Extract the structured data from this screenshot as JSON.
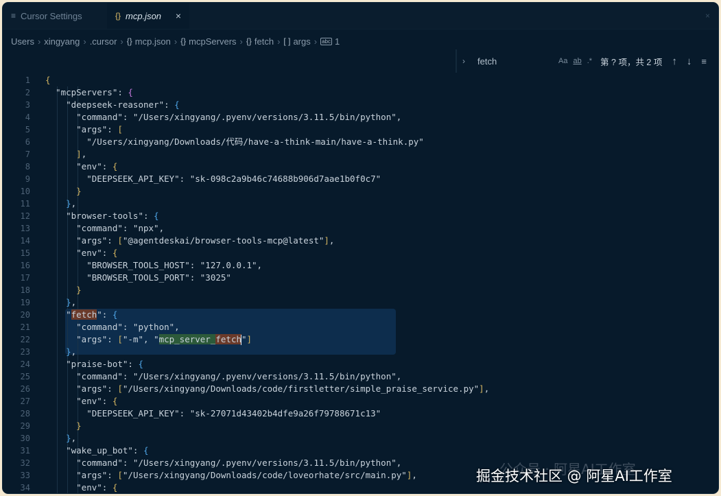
{
  "tabs": [
    {
      "label": "Cursor Settings",
      "icon": "settings-lines-icon",
      "active": false
    },
    {
      "label": "mcp.json",
      "icon": "json-braces-icon",
      "active": true
    }
  ],
  "breadcrumb": {
    "items": [
      "Users",
      "xingyang",
      ".cursor",
      "mcp.json",
      "mcpServers",
      "fetch",
      "args",
      "1"
    ],
    "icons": [
      "",
      "",
      "",
      "{}",
      "{}",
      "{}",
      "[ ]",
      "abc"
    ]
  },
  "find": {
    "query": "fetch",
    "match_case": "Aa",
    "whole_word": "ab",
    "regex": ".*",
    "result": "第 ? 项，共 2 项"
  },
  "code_lines": [
    "{",
    "  \"mcpServers\": {",
    "    \"deepseek-reasoner\": {",
    "      \"command\": \"/Users/xingyang/.pyenv/versions/3.11.5/bin/python\",",
    "      \"args\": [",
    "        \"/Users/xingyang/Downloads/代码/have-a-think-main/have-a-think.py\"",
    "      ],",
    "      \"env\": {",
    "        \"DEEPSEEK_API_KEY\": \"sk-098c2a9b46c74688b906d7aae1b0f0c7\"",
    "      }",
    "    },",
    "    \"browser-tools\": {",
    "      \"command\": \"npx\",",
    "      \"args\": [\"@agentdeskai/browser-tools-mcp@latest\"],",
    "      \"env\": {",
    "        \"BROWSER_TOOLS_HOST\": \"127.0.0.1\",",
    "        \"BROWSER_TOOLS_PORT\": \"3025\"",
    "      }",
    "    },",
    "    \"fetch\": {",
    "      \"command\": \"python\",",
    "      \"args\": [\"-m\", \"mcp_server_fetch\"]",
    "    },",
    "    \"praise-bot\": {",
    "      \"command\": \"/Users/xingyang/.pyenv/versions/3.11.5/bin/python\",",
    "      \"args\": [\"/Users/xingyang/Downloads/code/firstletter/simple_praise_service.py\"],",
    "      \"env\": {",
    "        \"DEEPSEEK_API_KEY\": \"sk-27071d43402b4dfe9a26f79788671c13\"",
    "      }",
    "    },",
    "    \"wake_up_bot\": {",
    "      \"command\": \"/Users/xingyang/.pyenv/versions/3.11.5/bin/python\",",
    "      \"args\": [\"/Users/xingyang/Downloads/code/loveorhate/src/main.py\"],",
    "      \"env\": {"
  ],
  "watermark": "掘金技术社区 @ 阿星AI工作室",
  "watermark_ghost": "公众号 · 阿星AI工作室",
  "colors": {
    "editor_bg": "#071a2b",
    "selection": "#0d2d4d",
    "find_match": "#6a3a2a",
    "bracket_gold": "#d4b560",
    "bracket_purple": "#c678dd",
    "bracket_blue": "#4fa6e8"
  }
}
